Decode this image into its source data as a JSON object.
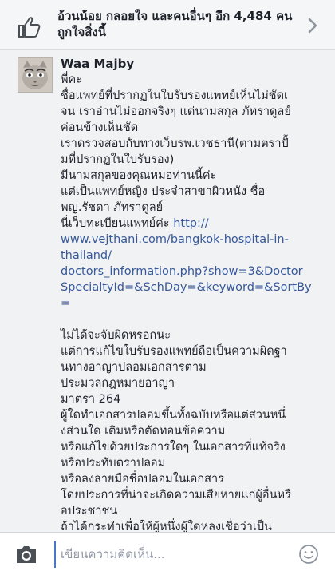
{
  "likes": {
    "text": "อ้วนน้อย กลอยใจ และคนอื่นๆ อีก 4,484 คนถูกใจสิ่งนี้"
  },
  "comment": {
    "author": "Waa Majby",
    "lines": [
      {
        "text": "พี่คะ",
        "link": false
      },
      {
        "text": "ชื่อแพทย์ที่ปรากฏในใบรับรองแพทย์เห็นไม่ชัดเ",
        "link": false
      },
      {
        "text": "จน เราอ่านไม่ออกจริงๆ แต่นามสกุล ภัทราดูลย์",
        "link": false
      },
      {
        "text": "ค่อนข้างเห็นชัด",
        "link": false
      },
      {
        "text": "เราตรวจสอบกับทางเว็บรพ.เวชธานี(ตามตราปั้",
        "link": false
      },
      {
        "text": "มที่ปรากฏในใบรับรอง)",
        "link": false
      },
      {
        "text": "มีนามสกุลของคุณหมอท่านนี้ค่ะ",
        "link": false
      },
      {
        "text": "แต่เป็นแพทย์หญิง ประจำสาขาผิวหนัง ชื่อ",
        "link": false
      },
      {
        "text": "พญ.รัชดา ภัทราดูลย์",
        "link": false
      },
      {
        "text": "นี่เว็บทะเบียนแพทย์ค่ะ ",
        "link": false,
        "url": "http://"
      },
      {
        "text": "www.vejthani.com/bangkok-hospital-in-",
        "link": true
      },
      {
        "text": "thailand/",
        "link": true
      },
      {
        "text": "doctors_information.php?show=3&Doctor",
        "link": true
      },
      {
        "text": "SpecialtyId=&SchDay=&keyword=&SortBy",
        "link": true
      },
      {
        "text": "=",
        "link": true
      },
      {
        "text": "",
        "link": false
      },
      {
        "text": "ไม่ได้จะจับผิดหรอกนะ",
        "link": false
      },
      {
        "text": "แต่การแก้ไขใบรับรองแพทย์ถือเป็นความผิดฐา",
        "link": false
      },
      {
        "text": "นทางอาญาปลอมเอกสารตาม",
        "link": false
      },
      {
        "text": "ประมวลกฎหมายอาญา",
        "link": false
      },
      {
        "text": "มาตรา 264",
        "link": false
      },
      {
        "text": "ผู้ใดทำเอกสารปลอมขึ้นทั้งฉบับหรือแต่ส่วนหนึ่",
        "link": false
      },
      {
        "text": "งส่วนใด เติมหรือตัดทอนข้อความ",
        "link": false
      },
      {
        "text": "หรือแก้ไขด้วยประการใดๆ ในเอกสารที่แท้จริง",
        "link": false
      },
      {
        "text": "หรือประทับตราปลอม",
        "link": false
      },
      {
        "text": "หรือลงลายมือชื่อปลอมในเอกสาร",
        "link": false
      },
      {
        "text": "โดยประการที่น่าจะเกิดความเสียหายแก่ผู้อื่นหรื",
        "link": false
      },
      {
        "text": "อประชาชน",
        "link": false
      },
      {
        "text": "ถ้าได้กระทำเพื่อให้ผู้หนึ่งผู้ใดหลงเชื่อว่าเป็น",
        "link": false
      }
    ]
  },
  "compose": {
    "placeholder": "เขียนความคิดเห็น..."
  },
  "icons": {
    "like": "thumbs-up-icon",
    "chevron": "chevron-right-icon",
    "camera": "camera-icon",
    "emoji": "smiley-icon"
  },
  "colors": {
    "link": "#365899",
    "icon": "#4b4f56",
    "background": "#f1f2f4"
  }
}
